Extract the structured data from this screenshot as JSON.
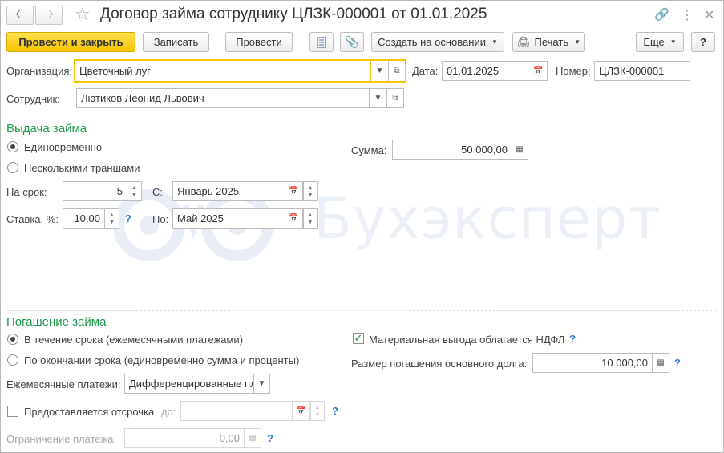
{
  "window": {
    "title": "Договор займа сотруднику ЦЛЗК-000001 от 01.01.2025"
  },
  "toolbar": {
    "post_and_close": "Провести и закрыть",
    "save": "Записать",
    "post": "Провести",
    "create_based_on": "Создать на основании",
    "print": "Печать",
    "more": "Еще",
    "help": "?"
  },
  "header": {
    "org_label": "Организация:",
    "org_value": "Цветочный луг",
    "date_label": "Дата:",
    "date_value": "01.01.2025",
    "number_label": "Номер:",
    "number_value": "ЦЛЗК-000001",
    "employee_label": "Сотрудник:",
    "employee_value": "Лютиков Леонид Львович"
  },
  "issue": {
    "title": "Выдача займа",
    "option_once": "Единовременно",
    "option_tranches": "Несколькими траншами",
    "amount_label": "Сумма:",
    "amount_value": "50 000,00",
    "term_label": "На срок:",
    "term_value": "5",
    "from_label": "С:",
    "from_value": "Январь 2025",
    "rate_label": "Ставка, %:",
    "rate_value": "10,00",
    "to_label": "По:",
    "to_value": "Май 2025",
    "help": "?"
  },
  "repay": {
    "title": "Погашение займа",
    "option_monthly": "В течение срока (ежемесячными платежами)",
    "option_end": "По окончании срока (единовременно сумма и проценты)",
    "benefit_label": "Материальная выгода облагается НДФЛ",
    "principal_label": "Размер погашения основного долга:",
    "principal_value": "10 000,00",
    "monthly_label": "Ежемесячные платежи:",
    "monthly_value": "Дифференцированные пл",
    "deferral_label": "Предоставляется отсрочка",
    "deferral_to_label": "до:",
    "limit_label": "Ограничение платежа:",
    "limit_value": "0,00",
    "help": "?"
  },
  "watermark": {
    "text": "Бухэксперт"
  }
}
